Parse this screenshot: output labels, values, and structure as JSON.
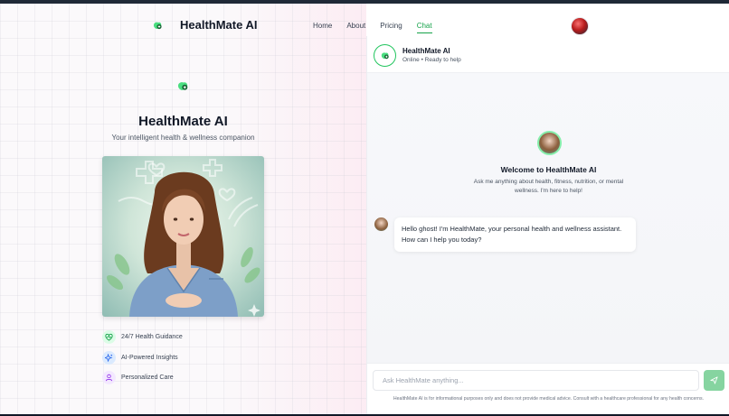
{
  "brand": {
    "name": "HealthMate AI"
  },
  "nav": {
    "items": [
      {
        "label": "Home"
      },
      {
        "label": "About"
      },
      {
        "label": "Pricing"
      },
      {
        "label": "Chat"
      }
    ],
    "active": "Chat"
  },
  "hero": {
    "title": "HealthMate AI",
    "subtitle": "Your intelligent health & wellness companion",
    "image_icon": "assistant-portrait-image"
  },
  "features": [
    {
      "label": "24/7 Health Guidance",
      "icon": "heart-pulse-icon",
      "color": "#16a34a"
    },
    {
      "label": "AI-Powered Insights",
      "icon": "sparkle-icon",
      "color": "#2563eb"
    },
    {
      "label": "Personalized Care",
      "icon": "user-icon",
      "color": "#9333ea"
    }
  ],
  "chat": {
    "name": "HealthMate AI",
    "status": "Online • Ready to help",
    "welcome_title": "Welcome to HealthMate AI",
    "welcome_text": "Ask me anything about health, fitness, nutrition, or mental wellness. I'm here to help!",
    "message": "Hello ghost! I'm HealthMate, your personal health and wellness assistant. How can I help you today?",
    "input_placeholder": "Ask HealthMate anything...",
    "disclaimer": "HealthMate AI is for informational purposes only and does not provide medical advice. Consult with a healthcare professional for any health concerns."
  },
  "colors": {
    "accent": "#16a34a",
    "send_button": "#86d4a0"
  }
}
